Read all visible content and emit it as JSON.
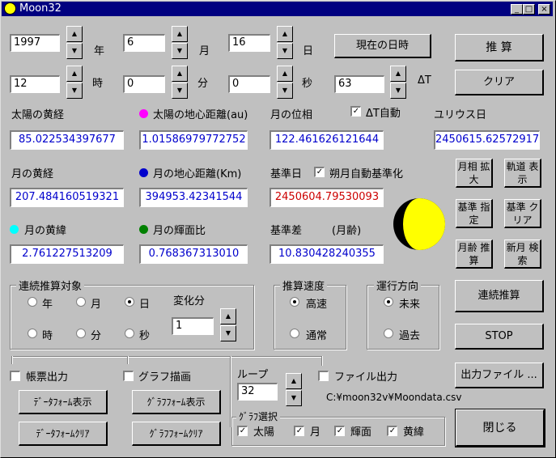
{
  "window": {
    "title": "Moon32"
  },
  "date": {
    "year": "1997",
    "year_unit": "年",
    "month": "6",
    "month_unit": "月",
    "day": "16",
    "day_unit": "日",
    "hour": "12",
    "hour_unit": "時",
    "minute": "0",
    "minute_unit": "分",
    "second": "0",
    "second_unit": "秒",
    "delta_t": "63",
    "delta_t_label": "ΔT",
    "now_button": "現在の日時"
  },
  "buttons": {
    "calc": "推 算",
    "clear": "クリア",
    "phase_zoom": "月相 拡大",
    "orbit_view": "軌道 表示",
    "base_set": "基準 指定",
    "base_clear": "基準 クリア",
    "age_calc": "月齢 推算",
    "newmoon_search": "新月 検索",
    "continuous": "連続推算",
    "stop": "STOP",
    "output_file": "出力ファイル ...",
    "close": "閉じる",
    "data_form_show": "ﾃﾞｰﾀﾌｫｰﾑ表示",
    "graph_form_show": "ｸﾞﾗﾌﾌｫｰﾑ表示",
    "data_form_clear": "ﾃﾞｰﾀﾌｫｰﾑｸﾘｱ",
    "graph_form_clear": "ｸﾞﾗﾌﾌｫｰﾑｸﾘｱ"
  },
  "results": {
    "sun_longitude_label": "太陽の黄経",
    "sun_longitude": "85.022534397677",
    "sun_distance_label": "太陽の地心距離(au)",
    "sun_distance": "1.01586979772752",
    "moon_phase_label": "月の位相",
    "moon_phase": "122.461626121644",
    "auto_dt_label": "ΔT自動",
    "auto_dt_checked": true,
    "julian_label": "ユリウス日",
    "julian": "2450615.62572917",
    "moon_longitude_label": "月の黄経",
    "moon_longitude": "207.484160519321",
    "moon_distance_label": "月の地心距離(Km)",
    "moon_distance": "394953.42341544",
    "base_day_label": "基準日",
    "base_day": "2450604.79530093",
    "full_moon_auto_label": "朔月自動基準化",
    "full_moon_auto_checked": true,
    "moon_latitude_label": "月の黄緯",
    "moon_latitude": "2.761227513209",
    "moon_brightness_label": "月の輝面比",
    "moon_brightness": "0.768367313010",
    "base_diff_label": "基準差",
    "moon_age_label": "(月齢)",
    "base_diff": "10.830428240355"
  },
  "colors": {
    "sun_distance_dot": "#ff00ff",
    "moon_distance_dot": "#0000cc",
    "moon_latitude_dot": "#00ffff",
    "moon_brightness_dot": "#008000",
    "moon_lit": "#ffff00"
  },
  "continuous_target": {
    "title": "連続推算対象",
    "options": [
      "年",
      "月",
      "日",
      "時",
      "分",
      "秒"
    ],
    "selected": "日",
    "change_label": "変化分",
    "change_value": "1"
  },
  "speed": {
    "title": "推算速度",
    "options": [
      "高速",
      "通常"
    ],
    "selected": "高速"
  },
  "direction": {
    "title": "運行方向",
    "options": [
      "未来",
      "過去"
    ],
    "selected": "未来"
  },
  "output": {
    "ledger_label": "帳票出力",
    "ledger_checked": false,
    "graph_label": "グラフ描画",
    "graph_checked": false,
    "loop_label": "ループ",
    "loop_value": "32",
    "file_label": "ファイル出力",
    "file_checked": false,
    "file_path": "C:¥moon32v¥Moondata.csv"
  },
  "graph_select": {
    "title": "ｸﾞﾗﾌ選択",
    "items": [
      {
        "label": "太陽",
        "checked": true
      },
      {
        "label": "月",
        "checked": true
      },
      {
        "label": "輝面",
        "checked": true
      },
      {
        "label": "黄緯",
        "checked": true
      }
    ]
  }
}
